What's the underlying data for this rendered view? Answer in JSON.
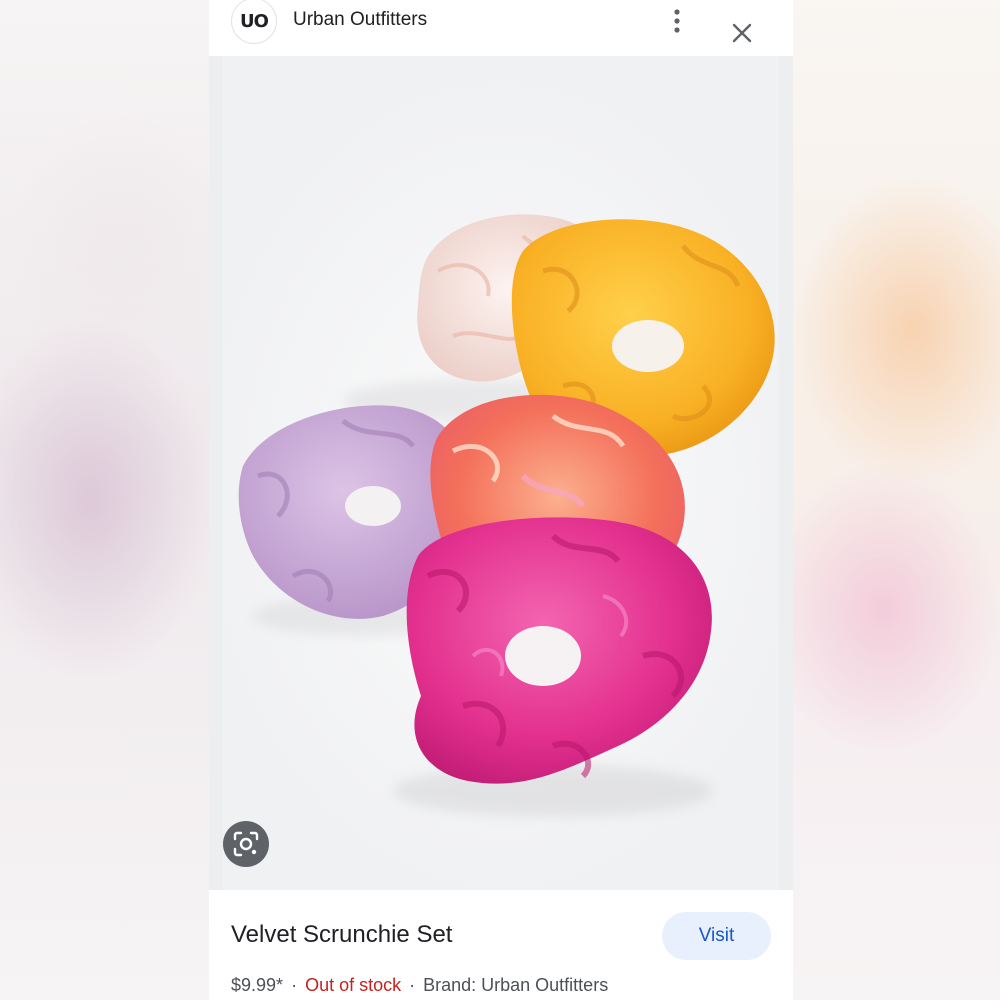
{
  "header": {
    "logo_text": "UO",
    "source_name": "Urban Outfitters",
    "more_icon": "more-vertical-icon",
    "close_icon": "close-icon"
  },
  "image": {
    "lens_icon": "lens-search-icon",
    "scrunchie_colors": [
      "#f4e4e4",
      "#f9b32a",
      "#c9a3d8",
      "#f07a5e",
      "#e8318f"
    ]
  },
  "product": {
    "title": "Velvet Scrunchie Set",
    "visit_label": "Visit",
    "price": "$9.99*",
    "separator": "·",
    "stock_status": "Out of stock",
    "brand": "Brand: Urban Outfitters",
    "stock_color": "#c5221f",
    "visit_bg_color": "#e8f0fe",
    "visit_text_color": "#1a56c5"
  }
}
